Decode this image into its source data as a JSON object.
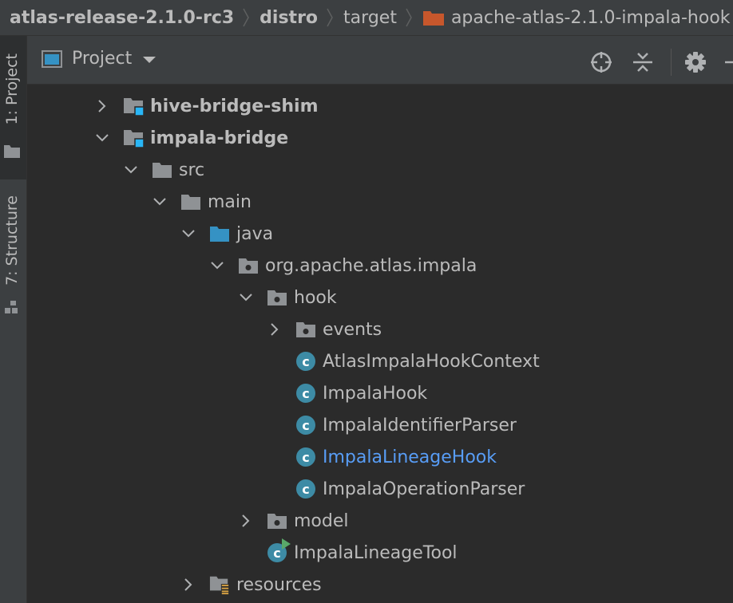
{
  "breadcrumb": {
    "items": [
      "atlas-release-2.1.0-rc3",
      "distro",
      "target",
      "apache-atlas-2.1.0-impala-hook"
    ]
  },
  "left_stripe": {
    "project_tab": "1: Project",
    "structure_tab": "7: Structure"
  },
  "tool_window": {
    "title": "Project",
    "icons": [
      "locate-icon",
      "collapse-all-icon",
      "gear-icon",
      "hide-icon"
    ]
  },
  "tree": {
    "rows": [
      {
        "label": "hive-bridge-shim",
        "icon": "module-folder-icon",
        "arrow": "collapsed",
        "bold": true
      },
      {
        "label": "impala-bridge",
        "icon": "module-folder-icon",
        "arrow": "expanded",
        "bold": true
      },
      {
        "label": "src",
        "icon": "folder-icon",
        "arrow": "expanded"
      },
      {
        "label": "main",
        "icon": "folder-icon",
        "arrow": "expanded"
      },
      {
        "label": "java",
        "icon": "source-folder-icon",
        "arrow": "expanded"
      },
      {
        "label": "org.apache.atlas.impala",
        "icon": "package-icon",
        "arrow": "expanded"
      },
      {
        "label": "hook",
        "icon": "package-icon",
        "arrow": "expanded"
      },
      {
        "label": "events",
        "icon": "package-icon",
        "arrow": "collapsed"
      },
      {
        "label": "AtlasImpalaHookContext",
        "icon": "class-icon",
        "arrow": "none"
      },
      {
        "label": "ImpalaHook",
        "icon": "class-icon",
        "arrow": "none"
      },
      {
        "label": "ImpalaIdentifierParser",
        "icon": "class-icon",
        "arrow": "none"
      },
      {
        "label": "ImpalaLineageHook",
        "icon": "class-icon",
        "arrow": "none",
        "link": true
      },
      {
        "label": "ImpalaOperationParser",
        "icon": "class-icon",
        "arrow": "none"
      },
      {
        "label": "model",
        "icon": "package-icon",
        "arrow": "collapsed"
      },
      {
        "label": "ImpalaLineageTool",
        "icon": "runnable-class-icon",
        "arrow": "none"
      },
      {
        "label": "resources",
        "icon": "resources-folder-icon",
        "arrow": "collapsed"
      }
    ]
  },
  "colors": {
    "background": "#2b2b2b",
    "panel": "#3c3f41",
    "text": "#bbbbbb",
    "folder": "#8f9295",
    "source_folder": "#3592c4",
    "class_icon": "#3d8ba5",
    "link_text": "#589df6",
    "target_folder": "#c7572c",
    "run_badge": "#59a869"
  }
}
